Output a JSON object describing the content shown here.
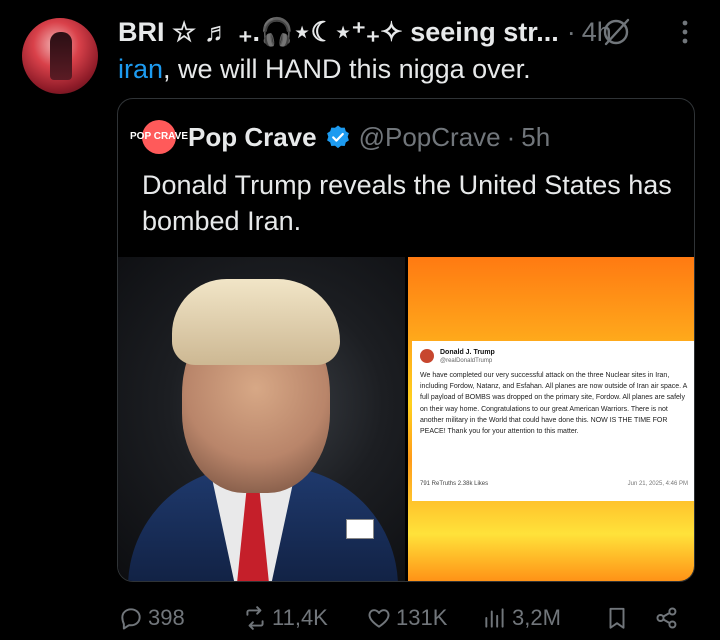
{
  "tweet": {
    "author_name": "BRI ☆ ♬ ₊.🎧⋆☾⋆⁺₊✧ seeing str...",
    "separator": "·",
    "time": "4h",
    "mention": "iran",
    "text": ", we will HAND this nigga over."
  },
  "quote": {
    "logo_text": "POP CRAVE",
    "name": "Pop Crave",
    "handle": "@PopCrave",
    "separator": "·",
    "time": "5h",
    "text": "Donald Trump reveals the United States has bombed Iran.",
    "embed": {
      "name": "Donald J. Trump",
      "handle": "@realDonaldTrump",
      "body": "We have completed our very successful attack on the three Nuclear sites in Iran, including Fordow, Natanz, and Esfahan. All planes are now outside of Iran air space. A full payload of BOMBS was dropped on the primary site, Fordow. All planes are safely on their way home. Congratulations to our great American Warriors. There is not another military in the World that could have done this. NOW IS THE TIME FOR PEACE! Thank you for your attention to this matter.",
      "stats": "791 ReTruths   2.38k Likes",
      "date": "Jun 21, 2025, 4:46 PM"
    }
  },
  "actions": {
    "replies": "398",
    "reposts": "11,4K",
    "likes": "131K",
    "views": "3,2M"
  },
  "colors": {
    "background": "#000000",
    "text": "#e7e9ea",
    "muted": "#71767b",
    "accent": "#1d9bf0",
    "border": "#2f3336"
  }
}
